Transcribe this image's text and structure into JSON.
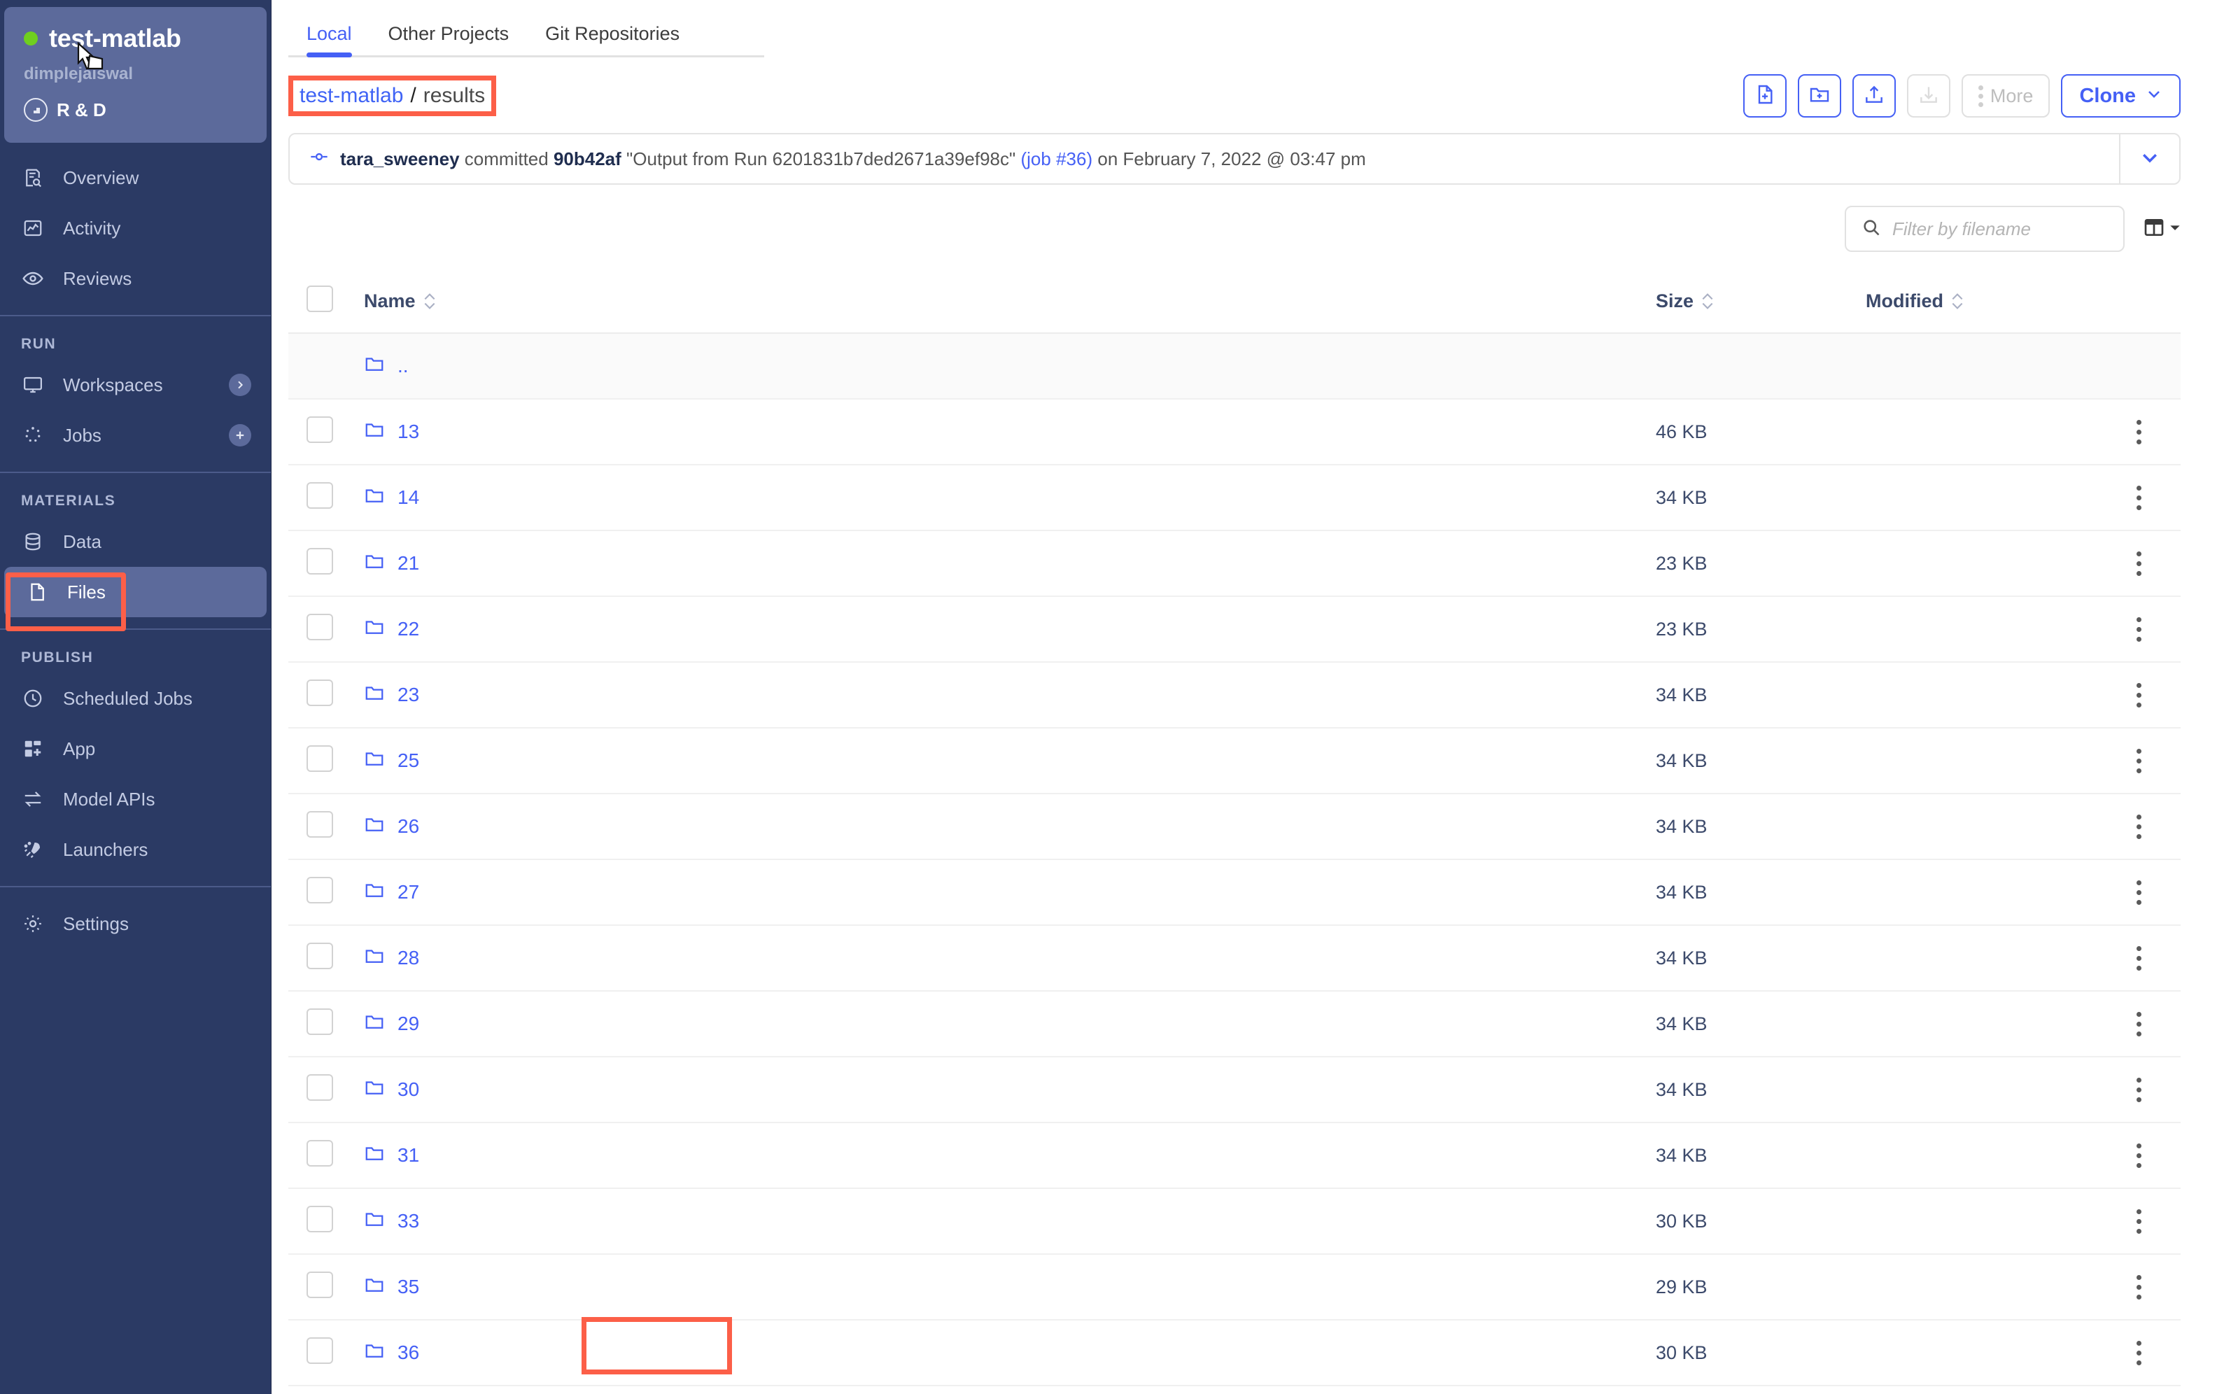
{
  "sidebar": {
    "project": {
      "name": "test-matlab",
      "owner": "dimplejaiswal",
      "team": "R & D",
      "status_color": "#6fcf1f"
    },
    "items": [
      {
        "label": "Overview",
        "icon": "overview-icon"
      },
      {
        "label": "Activity",
        "icon": "activity-icon"
      },
      {
        "label": "Reviews",
        "icon": "eye-icon"
      }
    ],
    "sections": [
      {
        "title": "RUN",
        "items": [
          {
            "label": "Workspaces",
            "icon": "monitor-icon",
            "badge": "chevron-right-badge"
          },
          {
            "label": "Jobs",
            "icon": "jobs-icon",
            "badge": "plus-badge"
          }
        ]
      },
      {
        "title": "MATERIALS",
        "items": [
          {
            "label": "Data",
            "icon": "database-icon",
            "badge": ""
          },
          {
            "label": "Files",
            "icon": "file-icon",
            "badge": "",
            "selected": true
          }
        ]
      },
      {
        "title": "PUBLISH",
        "items": [
          {
            "label": "Scheduled Jobs",
            "icon": "clock-icon",
            "badge": ""
          },
          {
            "label": "App",
            "icon": "app-icon",
            "badge": ""
          },
          {
            "label": "Model APIs",
            "icon": "exchange-icon",
            "badge": ""
          },
          {
            "label": "Launchers",
            "icon": "rocket-icon",
            "badge": ""
          }
        ]
      }
    ],
    "footer": [
      {
        "label": "Settings",
        "icon": "gear-icon"
      }
    ],
    "highlight_color": "#fc5f48"
  },
  "tabs": [
    {
      "label": "Local",
      "active": true
    },
    {
      "label": "Other Projects",
      "active": false
    },
    {
      "label": "Git Repositories",
      "active": false
    }
  ],
  "breadcrumb": {
    "root": "test-matlab",
    "separator": "/",
    "current": "results"
  },
  "toolbar": {
    "new_file_label": "new-file-icon",
    "new_folder_label": "new-folder-icon",
    "upload_label": "upload-icon",
    "download_label": "download-icon",
    "more_label": "More",
    "clone_label": "Clone"
  },
  "commit": {
    "author": "tara_sweeney",
    "verb": "committed",
    "hash": "90b42af",
    "message": "\"Output from Run 6201831b7ded2671a39ef98c\"",
    "job_link": "(job #36)",
    "timestamp": "on February 7, 2022 @ 03:47 pm"
  },
  "search": {
    "value": "",
    "placeholder": "Filter by filename"
  },
  "table": {
    "columns": [
      "Name",
      "Size",
      "Modified"
    ],
    "parent_row": {
      "name": "..",
      "size": "",
      "modified": ""
    },
    "rows": [
      {
        "name": "13",
        "size": "46 KB",
        "modified": ""
      },
      {
        "name": "14",
        "size": "34 KB",
        "modified": ""
      },
      {
        "name": "21",
        "size": "23 KB",
        "modified": ""
      },
      {
        "name": "22",
        "size": "23 KB",
        "modified": ""
      },
      {
        "name": "23",
        "size": "34 KB",
        "modified": ""
      },
      {
        "name": "25",
        "size": "34 KB",
        "modified": ""
      },
      {
        "name": "26",
        "size": "34 KB",
        "modified": ""
      },
      {
        "name": "27",
        "size": "34 KB",
        "modified": ""
      },
      {
        "name": "28",
        "size": "34 KB",
        "modified": ""
      },
      {
        "name": "29",
        "size": "34 KB",
        "modified": ""
      },
      {
        "name": "30",
        "size": "34 KB",
        "modified": ""
      },
      {
        "name": "31",
        "size": "34 KB",
        "modified": ""
      },
      {
        "name": "33",
        "size": "30 KB",
        "modified": ""
      },
      {
        "name": "35",
        "size": "29 KB",
        "modified": ""
      },
      {
        "name": "36",
        "size": "30 KB",
        "modified": "",
        "highlighted": true
      }
    ]
  },
  "colors": {
    "accent": "#4560f5",
    "sidebar_bg": "#2b3a64",
    "sidebar_card": "#5c6a9b",
    "highlight": "#fc5f48"
  }
}
